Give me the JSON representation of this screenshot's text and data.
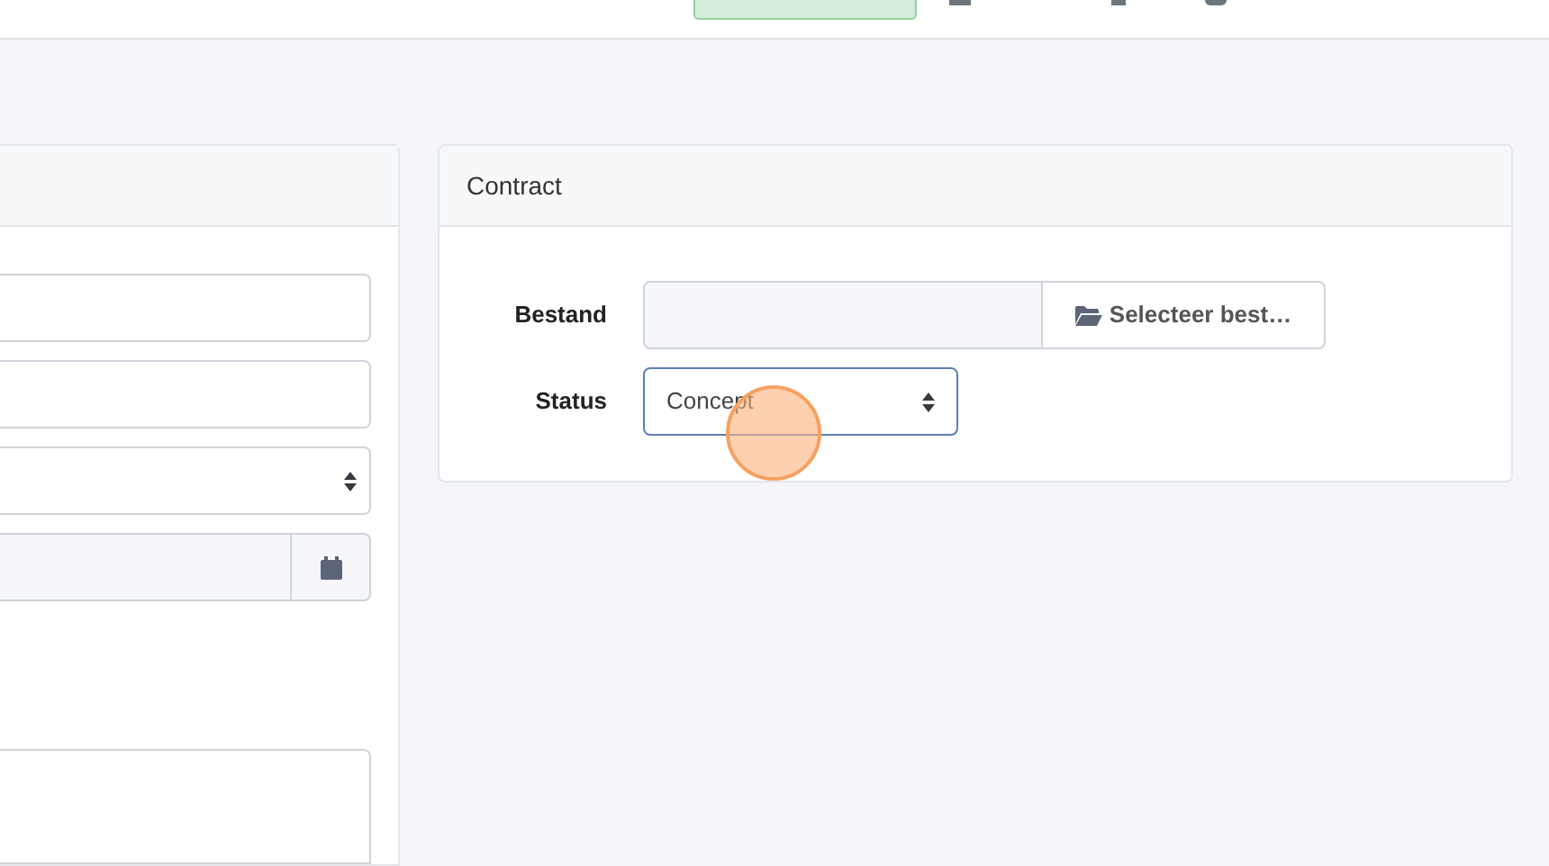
{
  "card": {
    "title": "Contract",
    "fields": [
      {
        "kind": "file",
        "label": "Bestand",
        "button": "Selecteer best…"
      },
      {
        "kind": "select",
        "label": "Status",
        "value": "Concept"
      }
    ]
  }
}
